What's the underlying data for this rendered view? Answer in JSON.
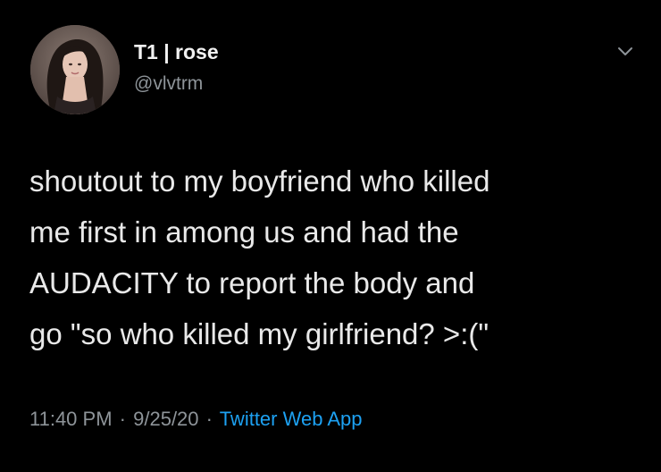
{
  "user": {
    "display_name": "T1 | rose",
    "handle": "@vlvtrm"
  },
  "tweet": {
    "text": "shoutout to my boyfriend who killed\nme first in among us and had the\nAUDACITY to report the body and\ngo \"so who killed my girlfriend? >:(\""
  },
  "meta": {
    "time": "11:40 PM",
    "separator": "·",
    "date": "9/25/20",
    "source": "Twitter Web App"
  },
  "icons": {
    "more_menu": "chevron-down-icon",
    "avatar": "profile-avatar"
  },
  "colors": {
    "background": "#000000",
    "text": "#e9e9e9",
    "secondary_text": "#8e9499",
    "link": "#1da1f2"
  }
}
